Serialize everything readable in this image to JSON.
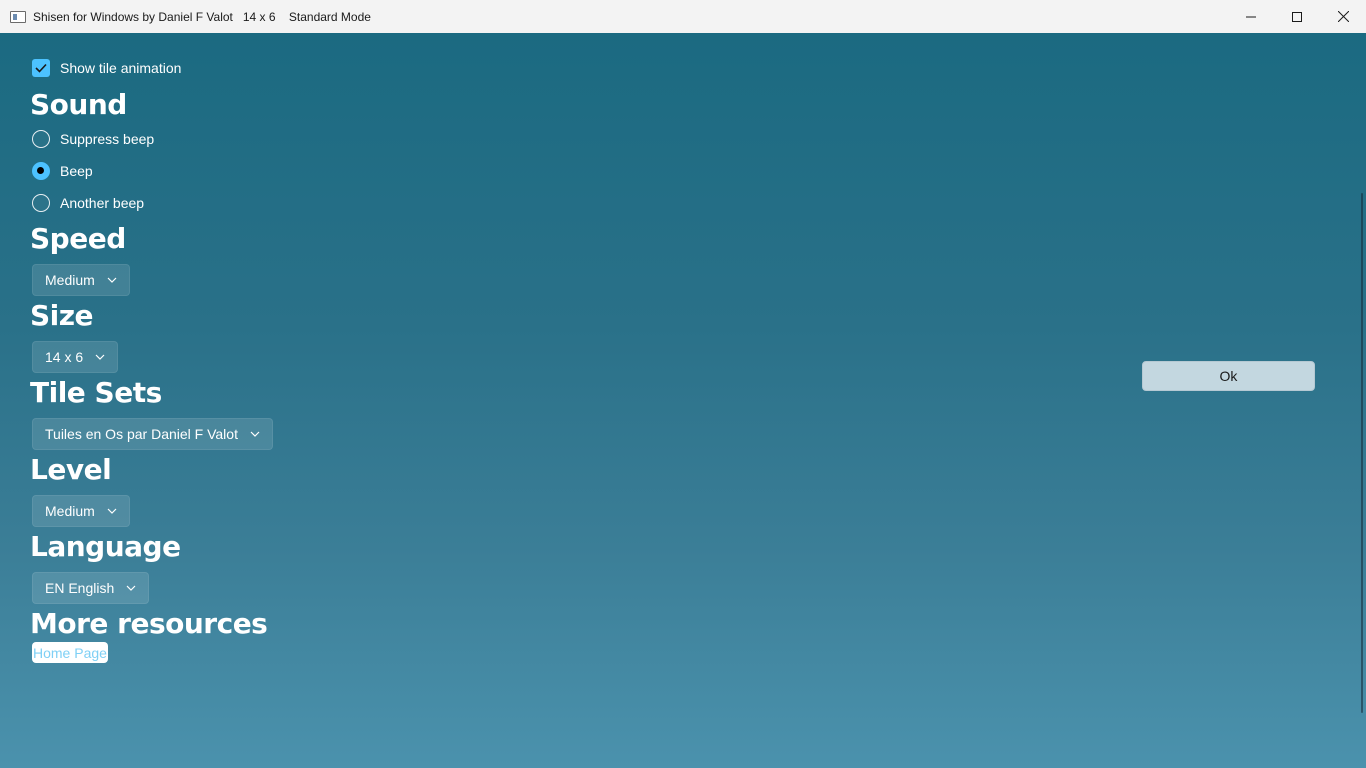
{
  "window": {
    "title": "Shisen for Windows by Daniel F Valot   14 x 6    Standard Mode",
    "minimize_icon": "minimize-icon",
    "maximize_icon": "maximize-icon",
    "close_icon": "close-icon"
  },
  "settings": {
    "show_tile_animation": {
      "label": "Show tile animation",
      "checked": true
    },
    "sound": {
      "title": "Sound",
      "options": [
        {
          "label": "Suppress beep",
          "selected": false
        },
        {
          "label": "Beep",
          "selected": true
        },
        {
          "label": "Another beep",
          "selected": false
        }
      ]
    },
    "speed": {
      "title": "Speed",
      "value": "Medium"
    },
    "size": {
      "title": "Size",
      "value": "14 x 6"
    },
    "tile_sets": {
      "title": "Tile Sets",
      "value": "Tuiles en Os par Daniel F Valot"
    },
    "level": {
      "title": "Level",
      "value": "Medium"
    },
    "language": {
      "title": "Language",
      "value": "EN English"
    },
    "more_resources": {
      "title": "More resources",
      "link_label": "Home Page"
    }
  },
  "ok_button": {
    "label": "Ok"
  },
  "colors": {
    "accent": "#4cc2ff",
    "background_top": "#1b6a81",
    "background_bottom": "#4b92ad",
    "ok_button_bg": "#c3d7e0"
  }
}
